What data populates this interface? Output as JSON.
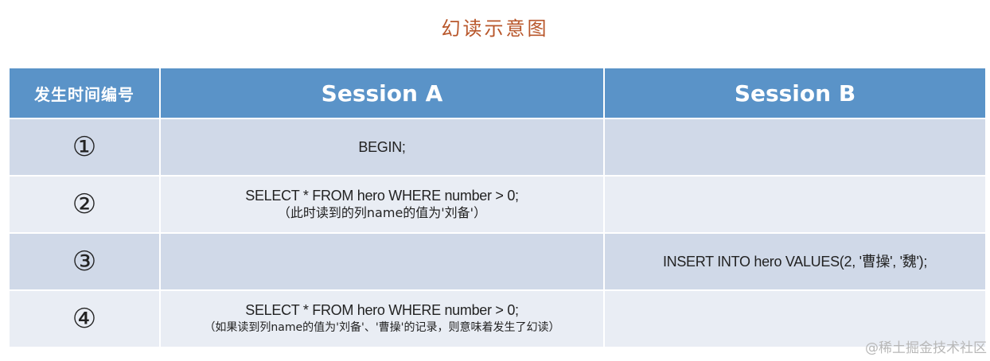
{
  "title": "幻读示意图",
  "table": {
    "headers": [
      "发生时间编号",
      "Session A",
      "Session B"
    ],
    "rows": [
      {
        "seq": "①",
        "session_a": {
          "sql": "BEGIN;",
          "note": ""
        },
        "session_b": {
          "sql": ""
        }
      },
      {
        "seq": "②",
        "session_a": {
          "sql": "SELECT * FROM hero WHERE number > 0;",
          "note": "（此时读到的列name的值为'刘备'）"
        },
        "session_b": {
          "sql": ""
        }
      },
      {
        "seq": "③",
        "session_a": {
          "sql": "",
          "note": ""
        },
        "session_b": {
          "sql": "INSERT INTO hero VALUES(2, '曹操', '魏');"
        }
      },
      {
        "seq": "④",
        "session_a": {
          "sql": "SELECT * FROM hero WHERE number > 0;",
          "note": "（如果读到列name的值为'刘备'、'曹操'的记录，则意味着发生了幻读）"
        },
        "session_b": {
          "sql": ""
        }
      }
    ]
  },
  "watermark": "@稀土掘金技术社区",
  "colors": {
    "header_bg": "#5a93c8",
    "row_dark": "#d0d9e8",
    "row_light": "#e9edf4",
    "title": "#b8562a"
  }
}
